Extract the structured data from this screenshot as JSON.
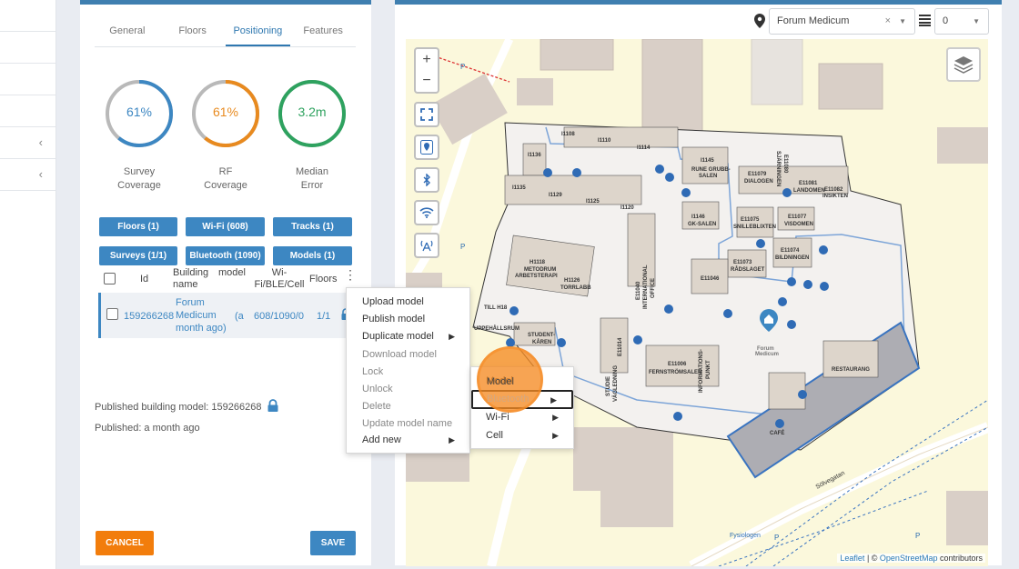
{
  "nav": {
    "chevron": "‹"
  },
  "tabs": [
    "General",
    "Floors",
    "Positioning",
    "Features"
  ],
  "gauges": [
    {
      "value": "61%",
      "label1": "Survey",
      "label2": "Coverage",
      "color": "#3d87c2",
      "percent": 0.61
    },
    {
      "value": "61%",
      "label1": "RF",
      "label2": "Coverage",
      "color": "#e88a1f",
      "percent": 0.61
    },
    {
      "value": "3.2m",
      "label1": "Median",
      "label2": "Error",
      "color": "#2ea25f",
      "percent": 1.0
    }
  ],
  "filters": {
    "floors": "Floors (1)",
    "wifi": "Wi-Fi (608)",
    "tracks": "Tracks (1)",
    "surveys": "Surveys (1/1)",
    "bluetooth": "Bluetooth (1090)",
    "models": "Models (1)"
  },
  "table": {
    "headers": {
      "id": "Id",
      "building": "Building name",
      "model": "model",
      "wifi": "Wi-Fi/BLE/Cell",
      "floors": "Floors"
    },
    "row": {
      "id": "159266268",
      "building": "Forum Medicum",
      "model": "(a month ago)",
      "model_l1": "(a",
      "model_l2": "month ago)",
      "wifi": "608/1090/0",
      "floors": "1/1"
    }
  },
  "published_model": "Published building model: 159266268",
  "published_time": "Published: a month ago",
  "buttons": {
    "cancel": "CANCEL",
    "save": "SAVE"
  },
  "map_toolbar": {
    "building": "Forum Medicum",
    "floor": "0"
  },
  "context_menu": [
    "Upload model",
    "Publish model",
    "Duplicate model",
    "Download model",
    "Lock",
    "Unlock",
    "Delete",
    "Update model name",
    "Add new"
  ],
  "submenu": [
    "Model",
    "Bluetooth",
    "Wi-Fi",
    "Cell"
  ],
  "map": {
    "zoom_in": "+",
    "zoom_out": "−",
    "rooms": [
      "I1108",
      "I1110",
      "I1114",
      "I1136",
      "I1145",
      "RUNE GRUBB-SALEN",
      "E11079 DIALOGEN",
      "E11080 SJÄRNINGEN",
      "E11081 LANDOMEN",
      "E11082 INSIKTEN",
      "I1135",
      "I1129",
      "I1125",
      "I1120",
      "I1146 GK-SALEN",
      "E11075 SNILLEBLIXTEN",
      "E11077 VISDOMEN",
      "E11040 INTERNATIONAL OFFICE",
      "E11074 BILDNINGEN",
      "E11073 RÅDSLAGET",
      "H1118 METODRUM ARBETSTERAPI",
      "H1126 TORRLABB",
      "E11046",
      "TILL H18",
      "UPPEHÅLLSRUM",
      "STUDENT-KÅREN",
      "E11014",
      "STUDIE VÄGLEDNING",
      "E11006 FERNSTRÖMSALEN",
      "INFORMATIONS-PUNKT",
      "Forum Medicum",
      "RESTAURANG",
      "CAFÉ",
      "Sölvegatan",
      "Fysiologen"
    ],
    "attrib_leaflet": "Leaflet",
    "attrib_sep": " | © ",
    "attrib_osm": "OpenStreetMap",
    "attrib_tail": " contributors"
  }
}
